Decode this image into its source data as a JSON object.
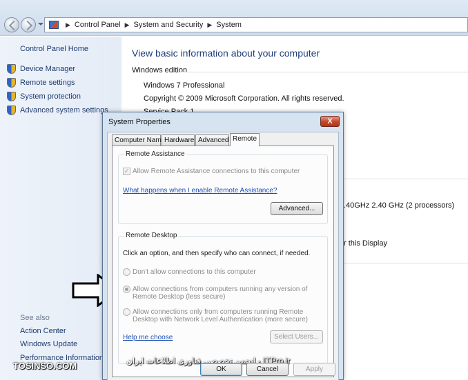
{
  "breadcrumb": [
    "Control Panel",
    "System and Security",
    "System"
  ],
  "sidebar": {
    "home": "Control Panel Home",
    "tasks": [
      "Device Manager",
      "Remote settings",
      "System protection",
      "Advanced system settings"
    ],
    "see_also_title": "See also",
    "see_also": [
      "Action Center",
      "Windows Update",
      "Performance Information a"
    ]
  },
  "main": {
    "heading": "View basic information about your computer",
    "section": "Windows edition",
    "edition": "Windows 7 Professional",
    "copyright": "Copyright © 2009 Microsoft Corporation.  All rights reserved.",
    "service_pack_partial": "Service Pack 1",
    "processor_partial": ".40GHz   2.40 GHz  (2 processors)",
    "display_partial": "r this Display"
  },
  "dialog": {
    "title": "System Properties",
    "close": "X",
    "tabs": [
      "Computer Name",
      "Hardware",
      "Advanced",
      "Remote"
    ],
    "remote_assistance": {
      "label": "Remote Assistance",
      "checkbox": "Allow Remote Assistance connections to this computer",
      "link": "What happens when I enable Remote Assistance?",
      "advanced_button": "Advanced..."
    },
    "remote_desktop": {
      "label": "Remote Desktop",
      "instruction": "Click an option, and then specify who can connect, if needed.",
      "options": [
        {
          "line1": "Don't allow connections to this computer",
          "line2": ""
        },
        {
          "line1": "Allow connections from computers running any version of",
          "line2": "Remote Desktop (less secure)"
        },
        {
          "line1": "Allow connections only from computers running Remote",
          "line2": "Desktop with Network Level Authentication (more secure)"
        }
      ],
      "help_link": "Help me choose",
      "select_users_button": "Select Users..."
    },
    "buttons": {
      "ok": "OK",
      "cancel": "Cancel",
      "apply": "Apply"
    }
  },
  "watermarks": {
    "left": "TOSINSO.COM",
    "right": "ITPro.ir - انجمن تخصصی فناوری اطلاعات ایران"
  }
}
